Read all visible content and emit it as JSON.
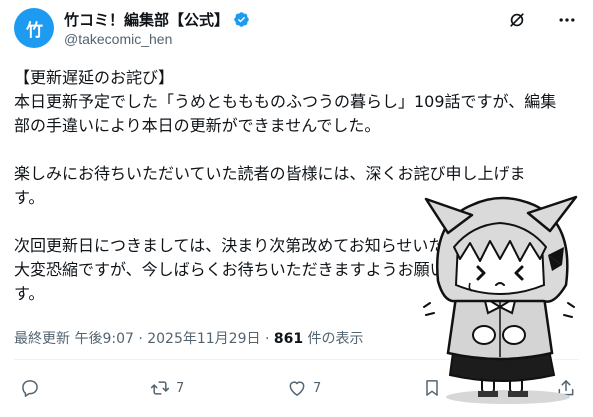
{
  "author": {
    "avatar_text": "竹",
    "display_name": "竹コミ！編集部【公式】",
    "handle": "@takecomic_hen"
  },
  "icons": {
    "verified": "verified-badge-icon",
    "grok": "grok-icon",
    "more": "more-icon",
    "reply": "reply-icon",
    "retweet": "retweet-icon",
    "like": "like-icon",
    "bookmark": "bookmark-icon",
    "share": "share-icon"
  },
  "tweet": {
    "lines": [
      "【更新遅延のお詫び】",
      "本日更新予定でした「うめとももものふつうの暮らし」109話ですが、編集",
      "部の手違いにより本日の更新ができませんでした。",
      "",
      "楽しみにお待ちいただいていた読者の皆様には、深くお詫び申し上げま",
      "す。",
      "",
      "次回更新日につきましては、決まり次第改めてお知らせいたします。",
      "大変恐縮ですが、今しばらくお待ちいただきますようお願いいたしま",
      "す。"
    ]
  },
  "meta": {
    "timestamp": "最終更新 午後9:07 · 2025年11月29日 · ",
    "views_count": "861",
    "views_label": " 件の表示"
  },
  "actions": {
    "reply_count": "",
    "retweet_count": "7",
    "like_count": "7"
  },
  "colors": {
    "accent": "#1d9bf0",
    "text": "#0f1419",
    "secondary": "#536471"
  }
}
